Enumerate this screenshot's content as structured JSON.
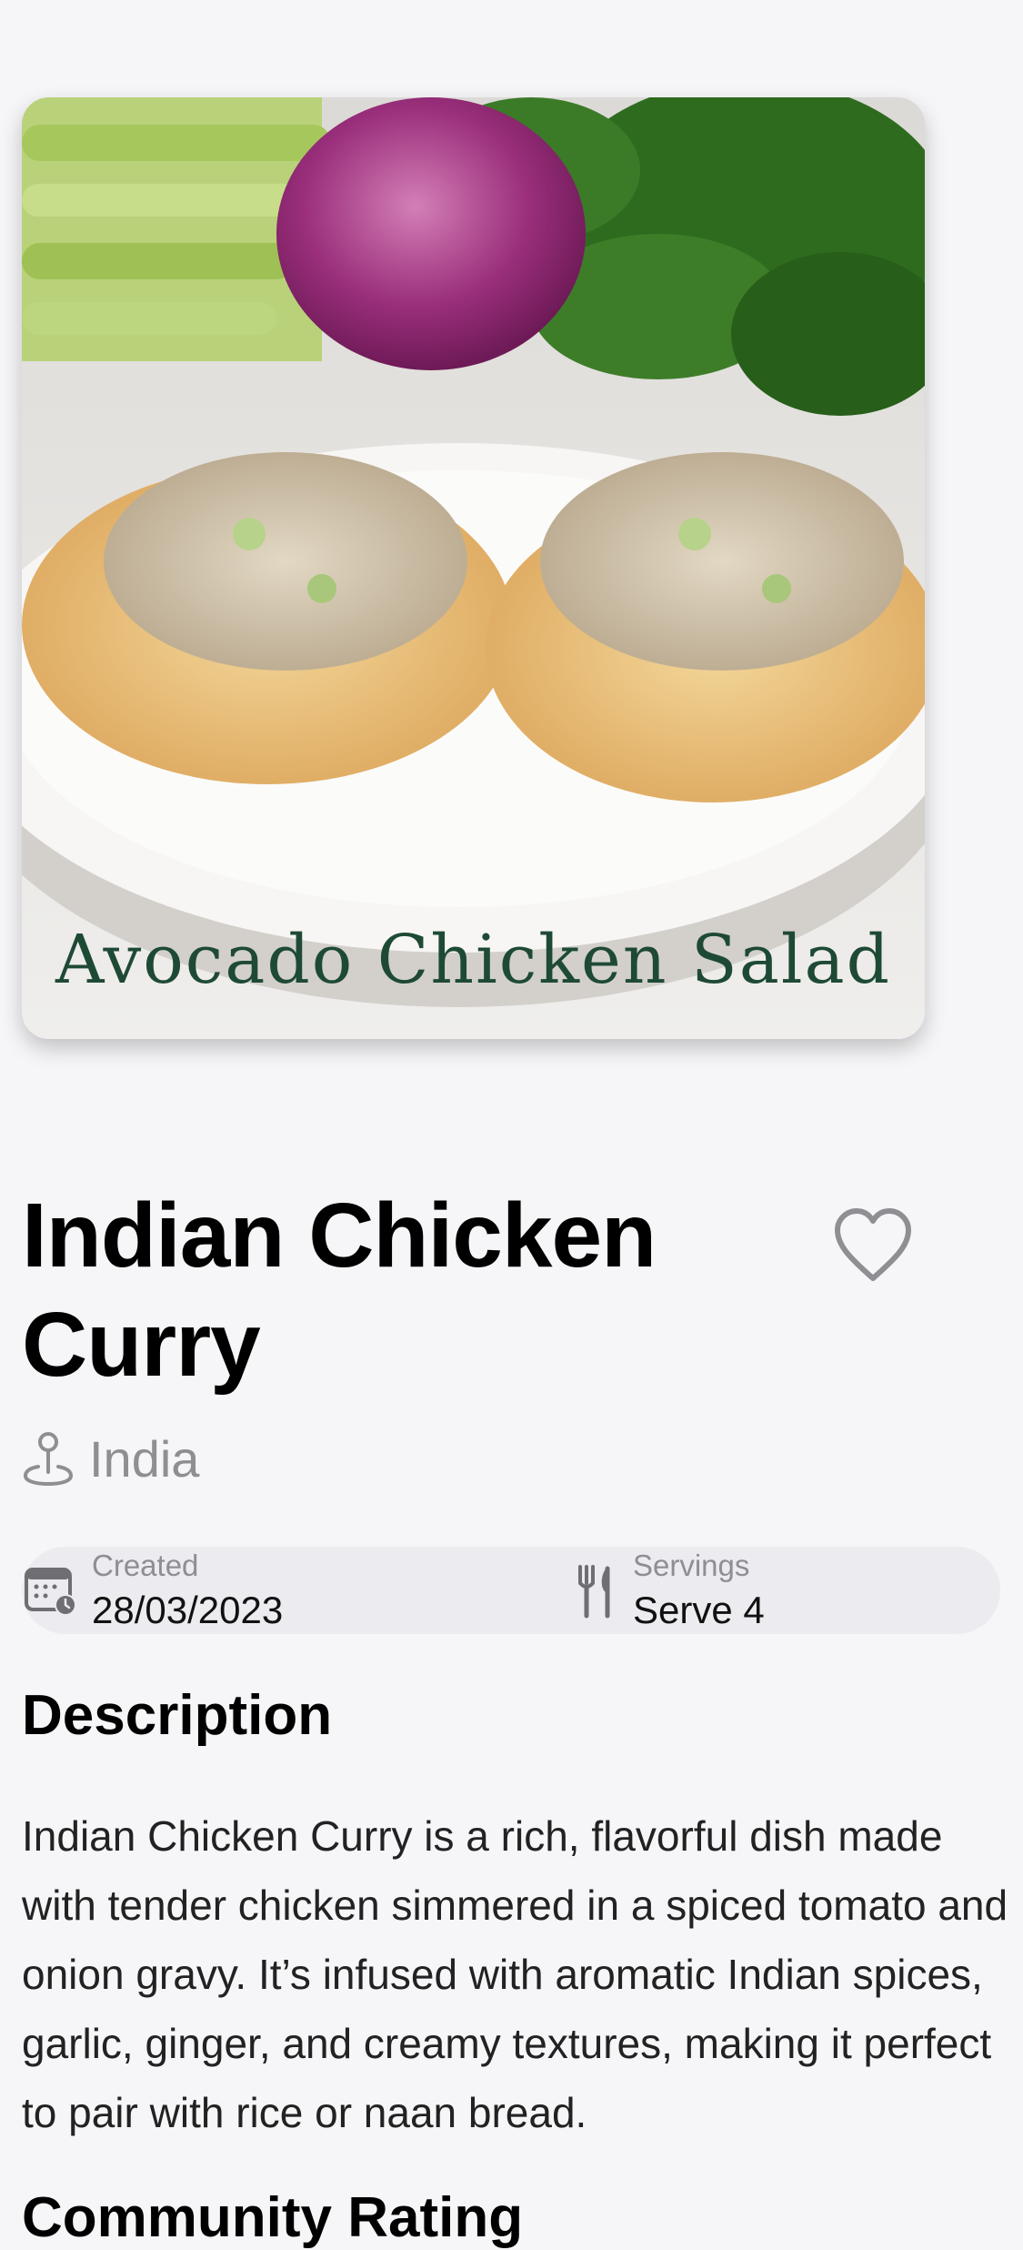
{
  "hero": {
    "caption": "Avocado Chicken Salad"
  },
  "recipe": {
    "title": "Indian Chicken Curry",
    "favorite": false,
    "location": "India"
  },
  "info": {
    "created_label": "Created",
    "created_value": "28/03/2023",
    "servings_label": "Servings",
    "servings_value": "Serve 4"
  },
  "description": {
    "heading": "Description",
    "text": "Indian Chicken Curry is a rich, flavorful dish made with tender chicken simmered in a spiced tomato and onion gravy. It’s infused with aromatic Indian spices, garlic, ginger, and creamy textures, making it perfect to pair with rice or naan bread."
  },
  "next_section": {
    "heading": "Community Rating"
  },
  "icons": {
    "favorite": "heart-icon",
    "location": "map-pin-icon",
    "created": "calendar-clock-icon",
    "servings": "fork-knife-icon"
  },
  "colors": {
    "background": "#f6f6f8",
    "secondary_text": "#8e8e93",
    "pill_background": "#ebebf0",
    "caption_green": "#1e4a35"
  }
}
